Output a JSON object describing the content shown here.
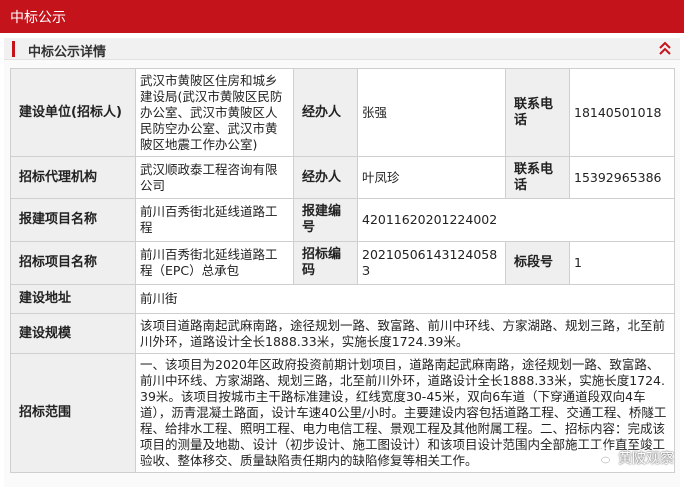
{
  "header": {
    "title": "中标公示"
  },
  "subheader": {
    "title": "中标公示详情"
  },
  "table": {
    "builder_label": "建设单位(招标人)",
    "builder_value": "武汉市黄陂区住房和城乡建设局(武汉市黄陂区民防办公室、武汉市黄陂区人民防空办公室、武汉市黄陂区地震工作办公室)",
    "handler_label": "经办人",
    "handler_value_1": "张强",
    "phone_label": "联系电话",
    "phone_value_1": "18140501018",
    "agency_label": "招标代理机构",
    "agency_value": "武汉顺政泰工程咨询有限公司",
    "handler_value_2": "叶凤珍",
    "phone_value_2": "15392965386",
    "report_name_label": "报建项目名称",
    "report_name_value": "前川百秀街北延线道路工程",
    "report_no_label": "报建编号",
    "report_no_value": "42011620201224002",
    "tender_name_label": "招标项目名称",
    "tender_name_value": "前川百秀街北延线道路工程（EPC）总承包",
    "tender_no_label": "招标编码",
    "tender_no_value": "20210506143124058З",
    "section_label": "标段号",
    "section_value": "1",
    "address_label": "建设地址",
    "address_value": "前川街",
    "scale_label": "建设规模",
    "scale_value": "该项目道路南起武麻南路，途径规划一路、致富路、前川中环线、方家湖路、规划三路，北至前川外环，道路设计全长1888.33米，实施长度1724.39米。",
    "scope_label": "招标范围",
    "scope_value": "一、该项目为2020年区政府投资前期计划项目，道路南起武麻南路，途径规划一路、致富路、前川中环线、方家湖路、规划三路，北至前川外环，道路设计全长1888.33米，实施长度1724.39米。该项目按城市主干路标准建设，红线宽度30-45米，双向6车道（下穿通道段双向4车道），沥青混凝土路面，设计车速40公里/小时。主要建设内容包括道路工程、交通工程、桥隧工程、给排水工程、照明工程、电力电信工程、景观工程及其他附属工程。二、招标内容：完成该项目的测量及地勘、设计（初步设计、施工图设计）和该项目设计范围内全部施工工作直至竣工验收、整体移交、质量缺陷责任期内的缺陷修复等相关工作。"
  },
  "watermark": {
    "text": "黄陂观察"
  },
  "colors": {
    "brand_red": "#c4131b",
    "label_bg": "#efefef",
    "border": "#cfcfcf"
  },
  "icons": {
    "collapse": "double-chevron-up-icon",
    "watermark": "wechat-logo-icon"
  }
}
